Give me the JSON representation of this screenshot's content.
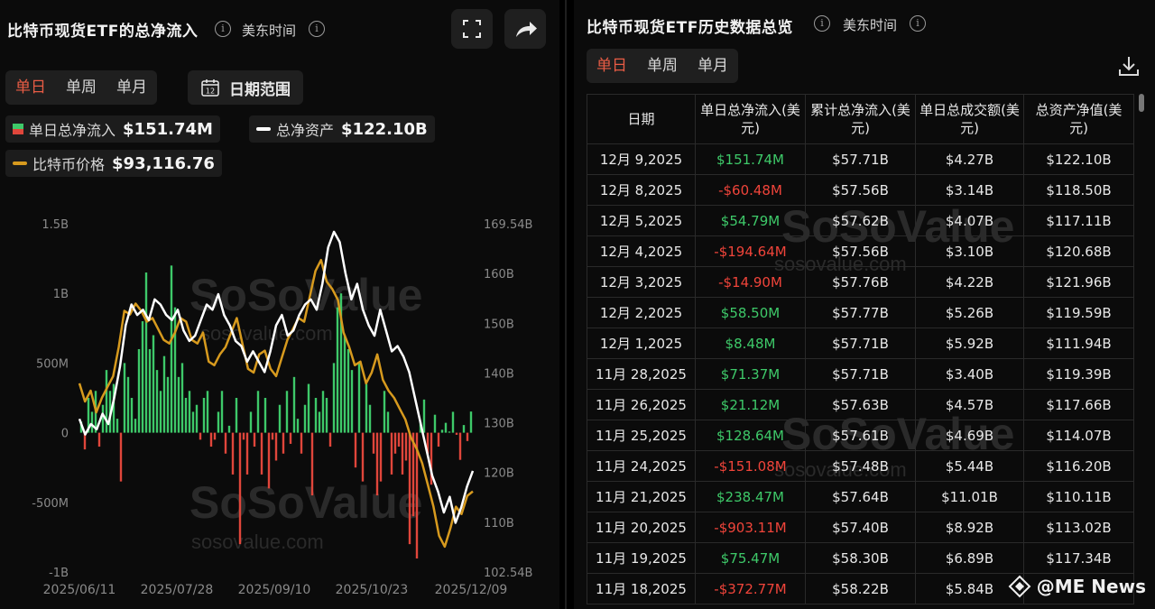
{
  "left": {
    "title": "比特币现货ETF的总净流入",
    "timezone": "美东时间",
    "tabs": [
      "单日",
      "单周",
      "单月"
    ],
    "active_tab": "单日",
    "date_range_label": "日期范围",
    "calendar_day": "12",
    "legend": {
      "daily_flow": {
        "label": "单日总净流入",
        "value": "$151.74M"
      },
      "total_assets": {
        "label": "总净资产",
        "value": "$122.10B"
      },
      "btc_price": {
        "label": "比特币价格",
        "value": "$93,116.76"
      }
    },
    "watermark": "SoSoValue",
    "watermark_url": "sosovalue.com"
  },
  "chart_data": {
    "type": "bar",
    "x_tick_labels": [
      "2025/06/11",
      "2025/07/28",
      "2025/09/10",
      "2025/10/23",
      "2025/12/09"
    ],
    "y_left_ticks": [
      "1.5B",
      "1B",
      "500M",
      "0",
      "-500M",
      "-1B"
    ],
    "y_right_ticks": [
      "169.54B",
      "160B",
      "150B",
      "140B",
      "130B",
      "120B",
      "110B",
      "102.54B"
    ],
    "ylim_left": [
      -1000,
      1500
    ],
    "ylim_right": [
      102.54,
      169.54
    ],
    "colors": {
      "positive": "#3ec969",
      "negative": "#e0463b",
      "assets_line": "#ffffff",
      "price_line": "#d79a1e"
    },
    "series": [
      {
        "name": "单日总净流入",
        "unit": "M",
        "values": [
          80,
          -120,
          250,
          150,
          300,
          -100,
          200,
          450,
          300,
          350,
          100,
          -350,
          500,
          400,
          250,
          100,
          600,
          800,
          1150,
          600,
          700,
          450,
          300,
          550,
          400,
          1200,
          900,
          400,
          500,
          250,
          300,
          150,
          200,
          -50,
          250,
          300,
          -100,
          -50,
          150,
          300,
          -150,
          50,
          -300,
          250,
          -800,
          -50,
          -300,
          150,
          -100,
          300,
          -300,
          250,
          -400,
          -50,
          -200,
          200,
          -150,
          300,
          -80,
          400,
          100,
          -150,
          200,
          350,
          -450,
          250,
          150,
          300,
          250,
          -100,
          500,
          900,
          1000,
          700,
          600,
          450,
          -250,
          500,
          -350,
          350,
          200,
          -150,
          -450,
          -350,
          300,
          150,
          -300,
          -150,
          -100,
          -300,
          -200,
          -800,
          -600,
          -903,
          75,
          238,
          -151,
          -373,
          129,
          -100,
          21,
          71,
          8,
          150,
          -15,
          -195,
          55,
          -60,
          152
        ]
      },
      {
        "name": "总净资产",
        "unit": "B",
        "values": [
          132,
          129,
          131,
          130,
          133,
          131,
          136,
          142,
          150,
          154,
          152,
          153,
          151,
          155,
          154,
          152,
          151,
          153,
          149,
          147,
          148,
          151,
          154,
          153,
          156,
          152,
          150,
          147,
          146,
          143,
          145,
          143,
          141,
          145,
          150,
          152,
          148,
          149,
          152,
          154,
          155,
          153,
          158,
          165,
          168,
          166,
          160,
          155,
          158,
          153,
          150,
          148,
          153,
          149,
          145,
          146,
          144,
          141,
          136,
          131,
          126,
          121,
          118,
          114,
          117,
          112,
          115,
          119,
          122
        ]
      },
      {
        "name": "比特币价格",
        "unit": "USD",
        "values": [
          108000,
          105500,
          107000,
          104000,
          106000,
          107500,
          109000,
          113000,
          118000,
          117500,
          119000,
          118000,
          116500,
          117000,
          115500,
          114000,
          113500,
          115000,
          117000,
          116500,
          114000,
          113500,
          115000,
          111000,
          110500,
          112000,
          113000,
          115000,
          117000,
          113500,
          110000,
          109500,
          112000,
          112500,
          110000,
          109000,
          111500,
          114000,
          115500,
          117000,
          116500,
          120000,
          123500,
          125000,
          122000,
          121000,
          119500,
          115000,
          113000,
          110500,
          111000,
          108000,
          109500,
          112000,
          108500,
          107000,
          106000,
          104500,
          103000,
          100500,
          99000,
          97000,
          94000,
          91000,
          87000,
          85500,
          88000,
          91000,
          90000,
          92500,
          93116.76
        ]
      }
    ],
    "legend_placement": "top-left"
  },
  "right": {
    "title": "比特币现货ETF历史数据总览",
    "timezone": "美东时间",
    "tabs": [
      "单日",
      "单周",
      "单月"
    ],
    "active_tab": "单日",
    "columns": [
      "日期",
      "单日总净流入(美元)",
      "累计总净流入(美元)",
      "单日总成交额(美元)",
      "总资产净值(美元)"
    ],
    "rows": [
      {
        "date": "12月 9,2025",
        "flow": "$151.74M",
        "cum": "$57.71B",
        "vol": "$4.27B",
        "nav": "$122.10B",
        "sign": "pos"
      },
      {
        "date": "12月 8,2025",
        "flow": "-$60.48M",
        "cum": "$57.56B",
        "vol": "$3.14B",
        "nav": "$118.50B",
        "sign": "neg"
      },
      {
        "date": "12月 5,2025",
        "flow": "$54.79M",
        "cum": "$57.62B",
        "vol": "$4.07B",
        "nav": "$117.11B",
        "sign": "pos"
      },
      {
        "date": "12月 4,2025",
        "flow": "-$194.64M",
        "cum": "$57.56B",
        "vol": "$3.10B",
        "nav": "$120.68B",
        "sign": "neg"
      },
      {
        "date": "12月 3,2025",
        "flow": "-$14.90M",
        "cum": "$57.76B",
        "vol": "$4.22B",
        "nav": "$121.96B",
        "sign": "neg"
      },
      {
        "date": "12月 2,2025",
        "flow": "$58.50M",
        "cum": "$57.77B",
        "vol": "$5.26B",
        "nav": "$119.59B",
        "sign": "pos"
      },
      {
        "date": "12月 1,2025",
        "flow": "$8.48M",
        "cum": "$57.71B",
        "vol": "$5.92B",
        "nav": "$111.94B",
        "sign": "pos"
      },
      {
        "date": "11月 28,2025",
        "flow": "$71.37M",
        "cum": "$57.71B",
        "vol": "$3.40B",
        "nav": "$119.39B",
        "sign": "pos"
      },
      {
        "date": "11月 26,2025",
        "flow": "$21.12M",
        "cum": "$57.63B",
        "vol": "$4.57B",
        "nav": "$117.66B",
        "sign": "pos"
      },
      {
        "date": "11月 25,2025",
        "flow": "$128.64M",
        "cum": "$57.61B",
        "vol": "$4.69B",
        "nav": "$114.07B",
        "sign": "pos"
      },
      {
        "date": "11月 24,2025",
        "flow": "-$151.08M",
        "cum": "$57.48B",
        "vol": "$5.44B",
        "nav": "$116.20B",
        "sign": "neg"
      },
      {
        "date": "11月 21,2025",
        "flow": "$238.47M",
        "cum": "$57.64B",
        "vol": "$11.01B",
        "nav": "$110.11B",
        "sign": "pos"
      },
      {
        "date": "11月 20,2025",
        "flow": "-$903.11M",
        "cum": "$57.40B",
        "vol": "$8.92B",
        "nav": "$113.02B",
        "sign": "neg"
      },
      {
        "date": "11月 19,2025",
        "flow": "$75.47M",
        "cum": "$58.30B",
        "vol": "$6.89B",
        "nav": "$117.34B",
        "sign": "pos"
      },
      {
        "date": "11月 18,2025",
        "flow": "-$372.77M",
        "cum": "$58.22B",
        "vol": "$5.84B",
        "nav": "",
        "sign": "neg"
      }
    ],
    "watermark": "SoSoValue",
    "watermark_url": "sosovalue.com"
  },
  "brand": {
    "at": "@",
    "name": "ME News"
  }
}
